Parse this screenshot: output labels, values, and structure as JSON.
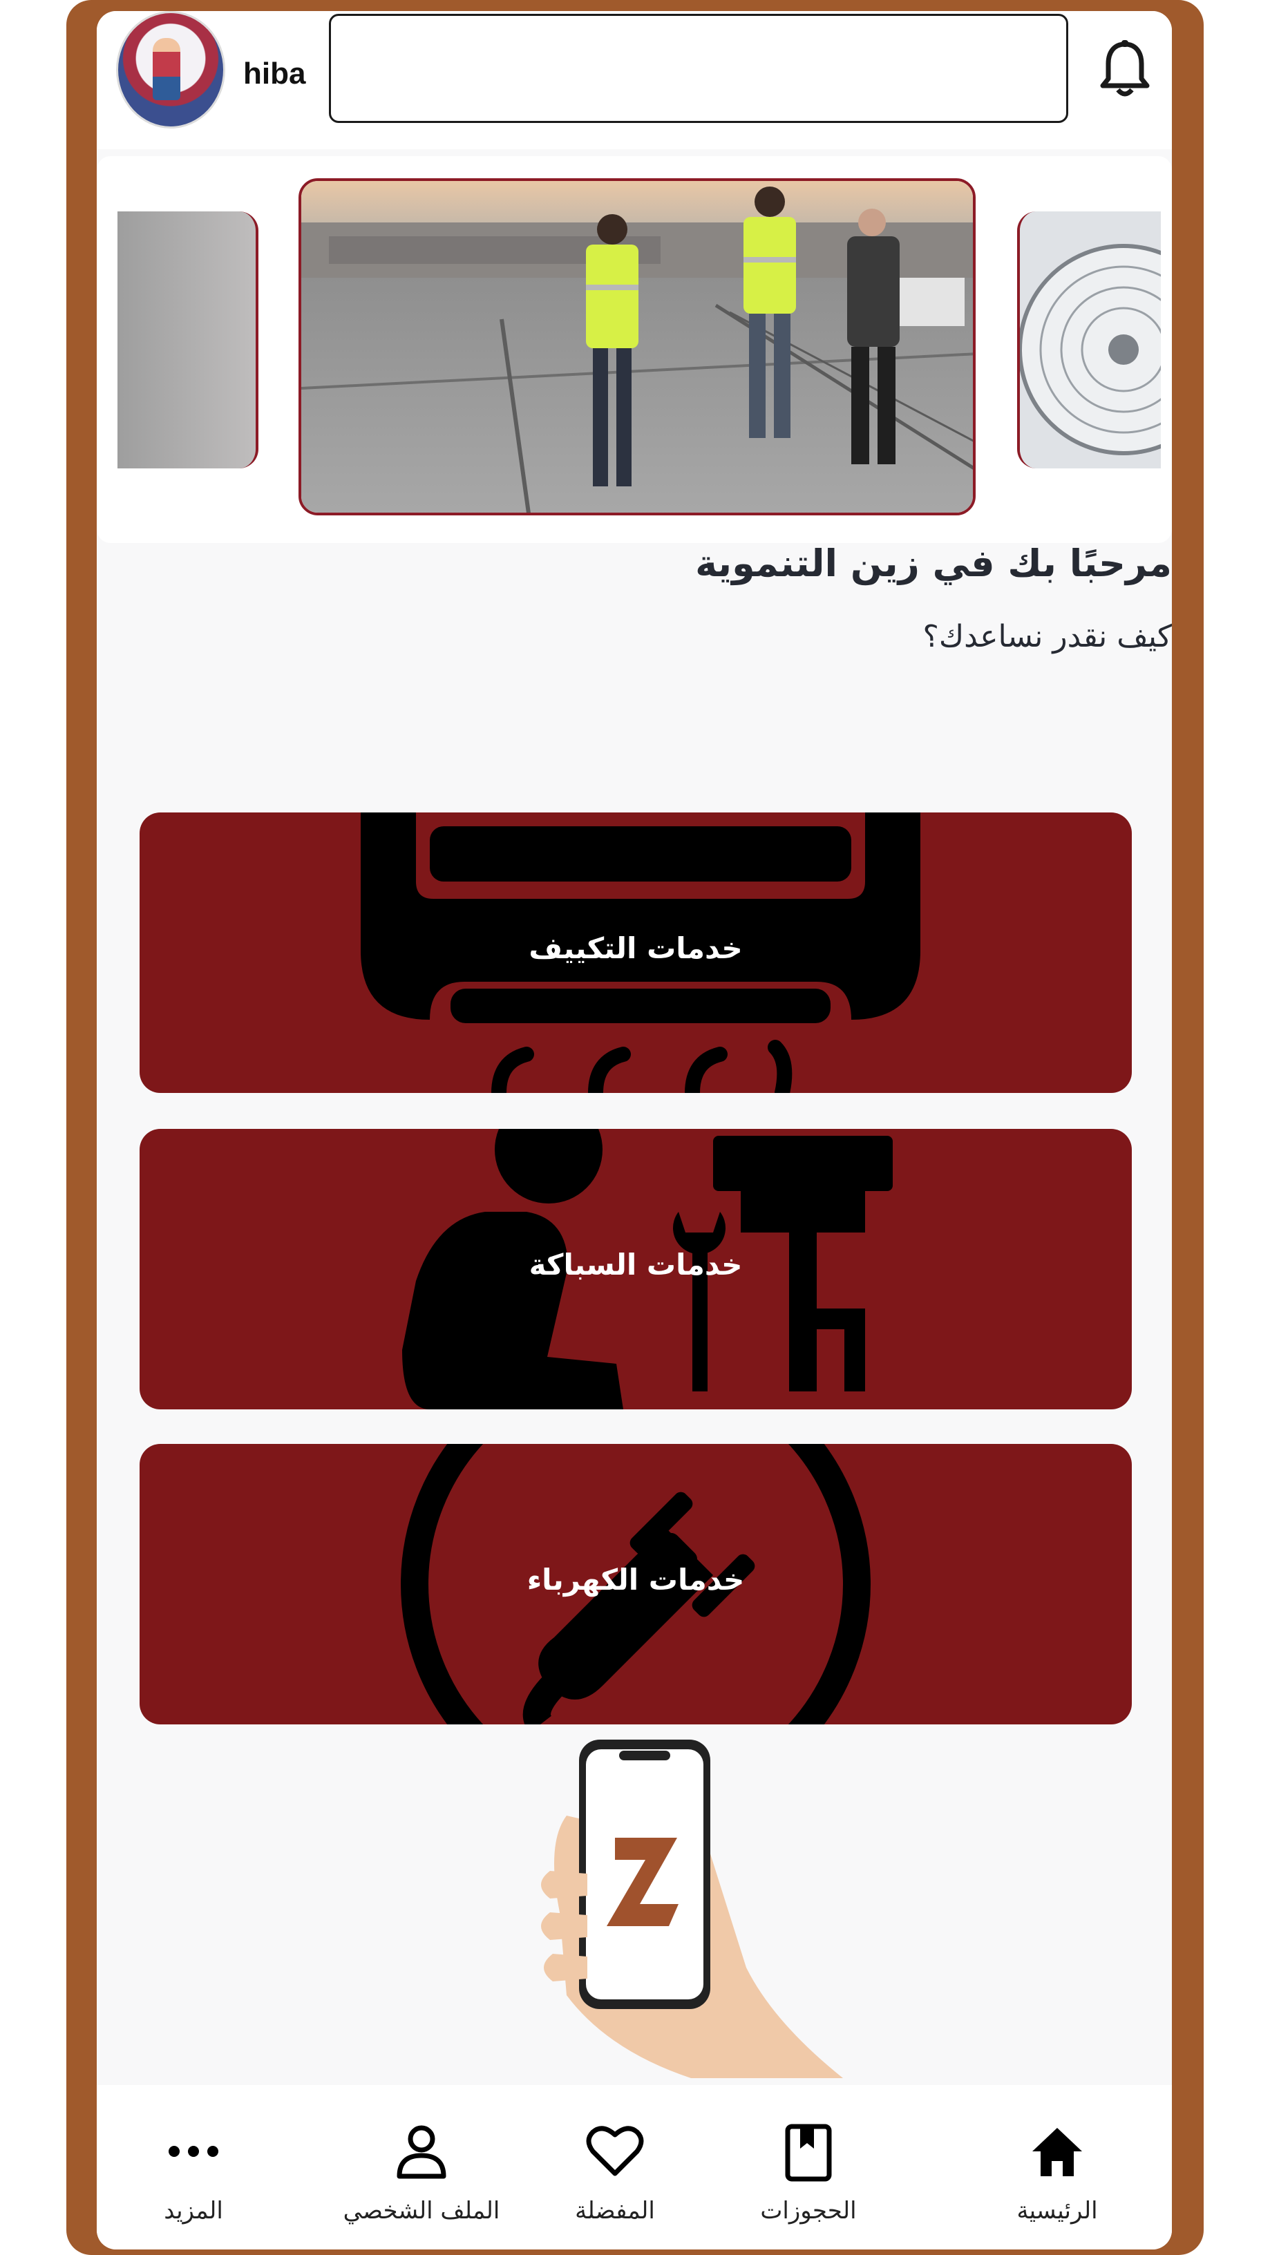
{
  "header": {
    "username": "hiba",
    "search": {
      "value": "",
      "placeholder": ""
    }
  },
  "welcome": {
    "title": "مرحبًا بك في زين التنموية",
    "subtitle": "كيف نقدر نساعدك؟"
  },
  "services": [
    {
      "label": "خدمات التكييف",
      "icon": "air-conditioner-icon"
    },
    {
      "label": "خدمات السباكة",
      "icon": "plumber-icon"
    },
    {
      "label": "خدمات الكهرباء",
      "icon": "electric-plug-icon"
    }
  ],
  "bottom_nav": {
    "items": [
      {
        "label": "الرئيسية",
        "icon": "home-icon",
        "active": true
      },
      {
        "label": "الحجوزات",
        "icon": "bookings-icon"
      },
      {
        "label": "المفضلة",
        "icon": "heart-icon"
      },
      {
        "label": "الملف الشخصي",
        "icon": "person-icon"
      },
      {
        "label": "المزيد",
        "icon": "more-icon"
      }
    ]
  },
  "colors": {
    "frame": "#a05a2c",
    "card": "#7e1719",
    "accent": "#8c1b26",
    "brand_logo": "#a0522d"
  }
}
